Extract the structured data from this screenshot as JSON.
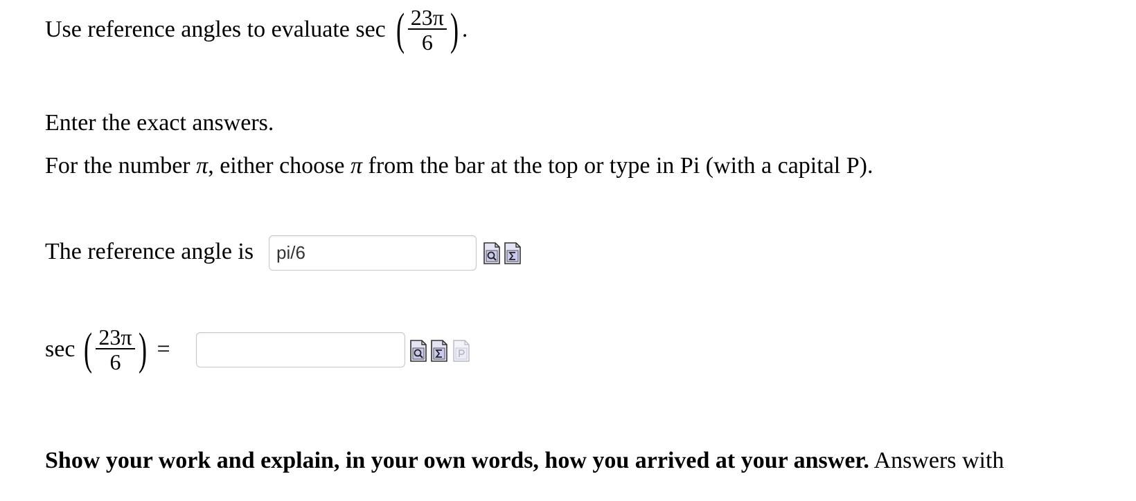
{
  "question": {
    "prefix": "Use reference angles to evaluate sec",
    "fraction_num": "23π",
    "fraction_den": "6",
    "suffix": "."
  },
  "instructions": {
    "line1": "Enter the exact answers.",
    "line2_a": "For the number ",
    "line2_pi1": "π",
    "line2_b": ", either choose ",
    "line2_pi2": "π",
    "line2_c": " from the bar at the top or type in Pi (with a capital P)."
  },
  "reference_angle": {
    "label": "The reference angle is",
    "value": "pi/6"
  },
  "sec_answer": {
    "func": "sec",
    "fraction_num": "23π",
    "fraction_den": "6",
    "equals": "=",
    "value": ""
  },
  "show_work": {
    "bold": "Show your work and explain, in your own words, how you arrived at your answer.",
    "rest": " Answers with"
  },
  "icons": [
    "preview-icon",
    "equation-editor-icon",
    "help-icon"
  ]
}
